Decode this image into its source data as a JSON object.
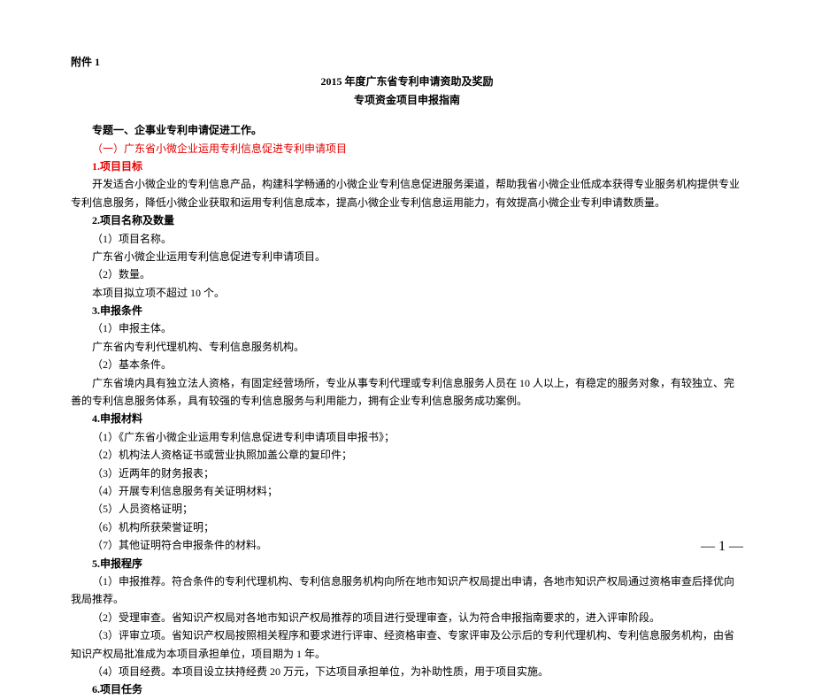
{
  "attachment": "附件 1",
  "title_line1": "2015 年度广东省专利申请资助及奖励",
  "title_line2": "专项资金项目申报指南",
  "topic_heading": "专题一、企事业专利申请促进工作。",
  "subsection_heading": "（一）广东省小微企业运用专利信息促进专利申请项目",
  "h1": "1.项目目标",
  "p1": "开发适合小微企业的专利信息产品，构建科学畅通的小微企业专利信息促进服务渠道，帮助我省小微企业低成本获得专业服务机构提供专业专利信息服务，降低小微企业获取和运用专利信息成本，提高小微企业专利信息运用能力，有效提高小微企业专利申请数质量。",
  "h2": "2.项目名称及数量",
  "p2a": "（1）项目名称。",
  "p2b": "广东省小微企业运用专利信息促进专利申请项目。",
  "p2c": "（2）数量。",
  "p2d": "本项目拟立项不超过 10 个。",
  "h3": "3.申报条件",
  "p3a": "（1）申报主体。",
  "p3b": "广东省内专利代理机构、专利信息服务机构。",
  "p3c": "（2）基本条件。",
  "p3d": "广东省境内具有独立法人资格，有固定经营场所，专业从事专利代理或专利信息服务人员在 10 人以上，有稳定的服务对象，有较独立、完善的专利信息服务体系，具有较强的专利信息服务与利用能力，拥有企业专利信息服务成功案例。",
  "h4": "4.申报材料",
  "p4a": "（1）《广东省小微企业运用专利信息促进专利申请项目申报书》；",
  "p4b": "（2）机构法人资格证书或营业执照加盖公章的复印件；",
  "p4c": "（3）近两年的财务报表；",
  "p4d": "（4）开展专利信息服务有关证明材料；",
  "p4e": "（5）人员资格证明；",
  "p4f": "（6）机构所获荣誉证明；",
  "p4g": "（7）其他证明符合申报条件的材料。",
  "h5": "5.申报程序",
  "p5a": "（1）申报推荐。符合条件的专利代理机构、专利信息服务机构向所在地市知识产权局提出申请，各地市知识产权局通过资格审查后择优向我局推荐。",
  "p5b": "（2）受理审查。省知识产权局对各地市知识产权局推荐的项目进行受理审查，认为符合申报指南要求的，进入评审阶段。",
  "p5c": "（3）评审立项。省知识产权局按照相关程序和要求进行评审、经资格审查、专家评审及公示后的专利代理机构、专利信息服务机构，由省知识产权局批准成为本项目承担单位，项目期为 1 年。",
  "p5d": "（4）项目经费。本项目设立扶持经费 20 万元，下达项目承担单位，为补助性质，用于项目实施。",
  "h6": "6.项目任务",
  "page_num": "— 1 —"
}
